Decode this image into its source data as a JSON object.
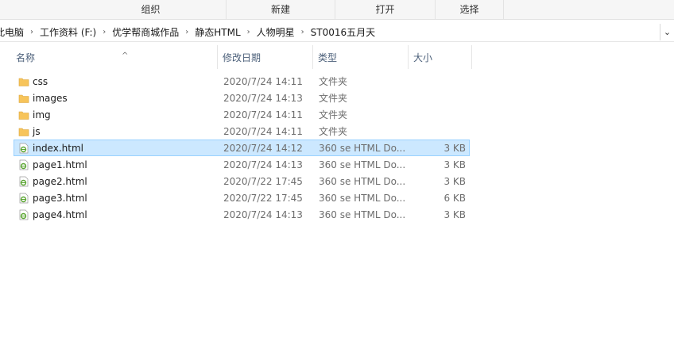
{
  "ribbon": {
    "groups": [
      "组织",
      "新建",
      "打开",
      "选择"
    ]
  },
  "address": {
    "crumbs": [
      "此电脑",
      "工作资料 (F:)",
      "优学帮商城作品",
      "静态HTML",
      "人物明星",
      "ST0016五月天"
    ],
    "separator": "›",
    "dropdown": "⌄"
  },
  "columns": {
    "name": "名称",
    "date": "修改日期",
    "type": "类型",
    "size": "大小"
  },
  "colors": {
    "selection": "#cce8ff",
    "folder": "#f7c45a",
    "html_icon": "#5aa532"
  },
  "files": [
    {
      "name": "css",
      "date": "2020/7/24 14:11",
      "type": "文件夹",
      "size": "",
      "icon": "folder-icon"
    },
    {
      "name": "images",
      "date": "2020/7/24 14:13",
      "type": "文件夹",
      "size": "",
      "icon": "folder-icon"
    },
    {
      "name": "img",
      "date": "2020/7/24 14:11",
      "type": "文件夹",
      "size": "",
      "icon": "folder-icon"
    },
    {
      "name": "js",
      "date": "2020/7/24 14:11",
      "type": "文件夹",
      "size": "",
      "icon": "folder-icon"
    },
    {
      "name": "index.html",
      "date": "2020/7/24 14:12",
      "type": "360 se HTML Do...",
      "size": "3 KB",
      "icon": "html-file-icon",
      "selected": true
    },
    {
      "name": "page1.html",
      "date": "2020/7/24 14:13",
      "type": "360 se HTML Do...",
      "size": "3 KB",
      "icon": "html-file-icon"
    },
    {
      "name": "page2.html",
      "date": "2020/7/22 17:45",
      "type": "360 se HTML Do...",
      "size": "3 KB",
      "icon": "html-file-icon"
    },
    {
      "name": "page3.html",
      "date": "2020/7/22 17:45",
      "type": "360 se HTML Do...",
      "size": "6 KB",
      "icon": "html-file-icon"
    },
    {
      "name": "page4.html",
      "date": "2020/7/24 14:13",
      "type": "360 se HTML Do...",
      "size": "3 KB",
      "icon": "html-file-icon"
    }
  ]
}
